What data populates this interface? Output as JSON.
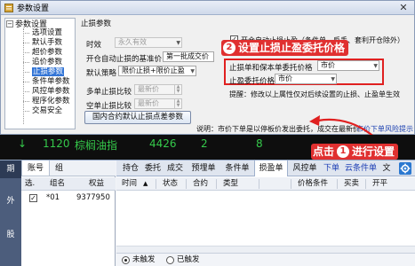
{
  "dialog": {
    "title": "参数设置",
    "close_glyph": "✕",
    "tree": {
      "root": "参数设置",
      "items": [
        "选项设置",
        "默认手数",
        "超价参数",
        "追价参数",
        "止损参数",
        "条件单参数",
        "风控单参数",
        "程序化参数",
        "交易安全"
      ],
      "selected": "止损参数"
    },
    "panel": {
      "section_title": "止损参数",
      "timeliness_label": "时效",
      "timeliness_value": "永久有效",
      "benchmark_label": "开仓自动止损的基准价",
      "benchmark_value": "第一批成交价",
      "default_strategy_label": "默认策略",
      "default_strategy_value": "限价止损+限价止盈",
      "multi_label": "多单止损比较",
      "multi_value": "最新价",
      "short_label": "空单止损比较",
      "short_value": "最新价",
      "domestic_button": "国内合约默认止损点差参数",
      "auto_stop_check": "✓",
      "auto_stop_label": "开仓自动止损止盈（条件单、反手、套利开仓除外）",
      "sl_order_label": "止损单和保本单委托价格",
      "sl_order_value": "市价",
      "tp_order_label": "止盈委托价格",
      "tp_order_value": "市价",
      "hint": "提醒：修改以上属性仅对后续设置的止损、止盈单生效",
      "note": "说明：市价下单是以停板价发出委托，成交在最新价",
      "risk_link": "市价下单风险提示"
    },
    "callout_2": {
      "num": "2",
      "text": "设置止损止盈委托价格"
    }
  },
  "ticker": {
    "items": [
      "1120",
      "棕榈油指",
      "4426",
      "2",
      "8"
    ]
  },
  "trade": {
    "vertical_tabs": [
      "期",
      "外",
      "股"
    ],
    "account": {
      "tabs": [
        "账号",
        "组"
      ],
      "headers": [
        "选.",
        "组名",
        "权益"
      ],
      "row": {
        "check": "✓",
        "name": "*01",
        "equity": "9377950"
      }
    },
    "order_tabs": [
      "持仓",
      "委托",
      "成交",
      "预埋单",
      "条件单",
      "损盈单",
      "风控单",
      "下单",
      "云条件单",
      "文"
    ],
    "order_headers": [
      "时间",
      "状态",
      "合约",
      "类型",
      "",
      "价格条件",
      "买卖",
      "开平"
    ],
    "radio_untriggered": "未触发",
    "radio_triggered": "已触发",
    "callout_1": {
      "prefix": "点击",
      "num": "1",
      "text": "进行设置"
    }
  },
  "colors": {
    "accent_red": "#e03030",
    "ticker_green": "#35c94b",
    "selection_blue": "#3375d6",
    "nav_blue": "#4c5d7c"
  }
}
